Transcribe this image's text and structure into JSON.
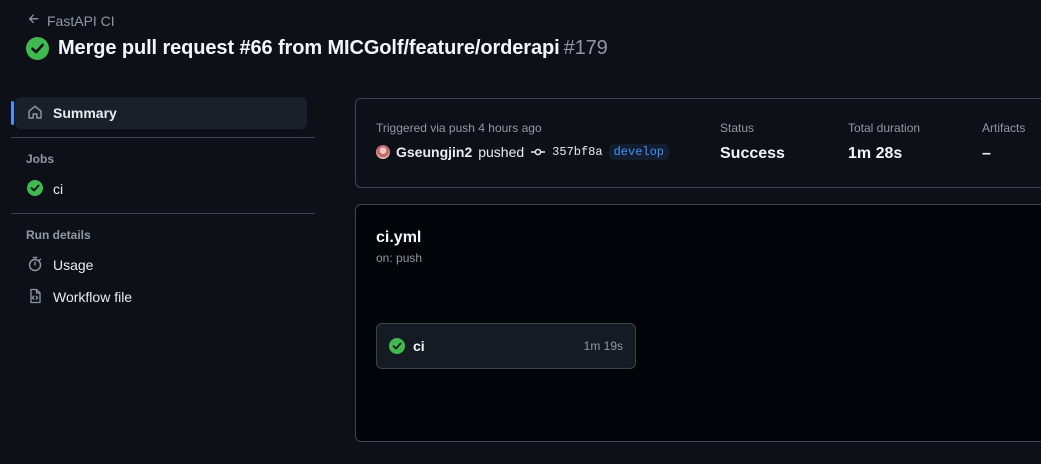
{
  "header": {
    "back_label": "FastAPI CI",
    "title": "Merge pull request #66 from MICGolf/feature/orderapi",
    "run_number": "#179"
  },
  "sidebar": {
    "summary_label": "Summary",
    "jobs_heading": "Jobs",
    "jobs": [
      {
        "label": "ci",
        "status": "success"
      }
    ],
    "run_details_heading": "Run details",
    "usage_label": "Usage",
    "workflow_file_label": "Workflow file"
  },
  "summary": {
    "trigger_text": "Triggered via push 4 hours ago",
    "actor": "Gseungjin2",
    "action": "pushed",
    "commit_sha": "357bf8a",
    "branch": "develop",
    "status_label": "Status",
    "status_value": "Success",
    "duration_label": "Total duration",
    "duration_value": "1m 28s",
    "artifacts_label": "Artifacts",
    "artifacts_value": "–"
  },
  "workflow": {
    "file_name": "ci.yml",
    "trigger": "on: push",
    "jobs": [
      {
        "name": "ci",
        "duration": "1m 19s",
        "status": "success"
      }
    ]
  },
  "colors": {
    "background": "#0d1117",
    "success": "#3fb950",
    "accent": "#4493f8",
    "border": "#3d444d"
  },
  "icons": [
    "arrow-left-icon",
    "check-circle-icon",
    "home-icon",
    "stopwatch-icon",
    "file-code-icon",
    "git-commit-icon"
  ]
}
